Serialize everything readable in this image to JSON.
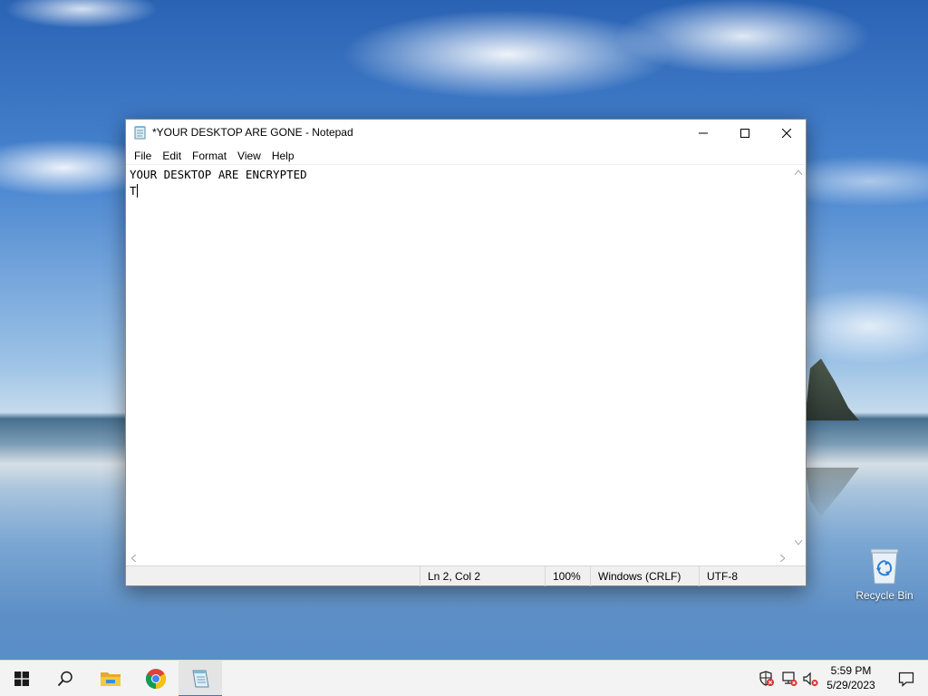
{
  "desktop": {
    "recycle_bin_label": "Recycle Bin"
  },
  "notepad": {
    "title": "*YOUR DESKTOP ARE GONE - Notepad",
    "menu": [
      "File",
      "Edit",
      "Format",
      "View",
      "Help"
    ],
    "content_lines": [
      "YOUR DESKTOP ARE ENCRYPTED",
      "T"
    ],
    "status": {
      "position": "Ln 2, Col 2",
      "zoom": "100%",
      "line_ending": "Windows (CRLF)",
      "encoding": "UTF-8"
    }
  },
  "taskbar": {
    "time": "5:59 PM",
    "date": "5/29/2023",
    "apps": [
      "start-icon",
      "search-icon",
      "file-explorer-icon",
      "chrome-icon",
      "notepad-icon"
    ],
    "tray_icons": [
      "security-warning-icon",
      "network-disconnected-icon",
      "volume-muted-icon"
    ]
  },
  "colors": {
    "accent": "#3a78c8",
    "windows_blue": "#0078d7"
  }
}
